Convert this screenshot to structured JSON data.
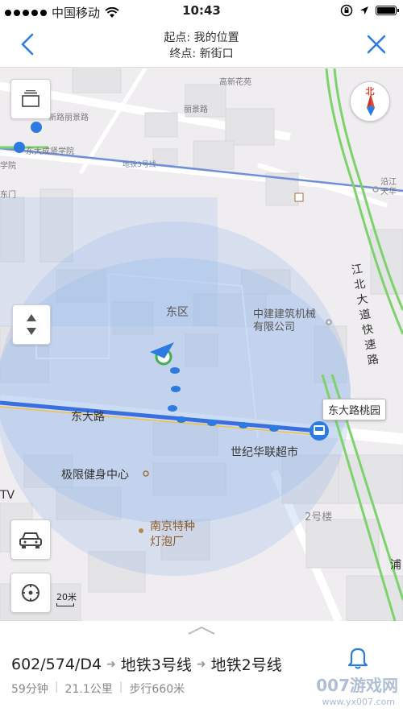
{
  "status": {
    "carrier": "中国移动",
    "time": "10:43"
  },
  "header": {
    "start": "起点: 我的位置",
    "end": "终点: 新街口"
  },
  "map": {
    "compass_label": "北",
    "labels": {
      "gaoxin_huayuan": "高新花苑",
      "liijing_road": "丽景路",
      "xinlu_lijing": "新路丽景路",
      "dongcheng": "东大成贤学院",
      "xueyuan": "学院",
      "dongmen": "东门",
      "metro3": "地铁3号线",
      "east_zone": "东区",
      "zhongjian": "中建建筑机械\n有限公司",
      "dongda_road": "东大路",
      "century": "世纪华联超市",
      "jixian": "极限健身中心",
      "nanjing": "南京特种\n灯泡厂",
      "building2": "2号楼",
      "tv": "TV",
      "pu": "浦",
      "jiangbei": "江北大道快速路",
      "yanjiang": "沿江\n天华"
    },
    "bus_stop_callout": "东大路桃园",
    "scale": "20米"
  },
  "panel": {
    "route": [
      "602/574/D4",
      "地铁3号线",
      "地铁2号线"
    ],
    "duration": "59分钟",
    "distance": "21.1公里",
    "walking": "步行660米",
    "watermark": "007游戏网",
    "watermark_url": "www.yx007.com"
  }
}
